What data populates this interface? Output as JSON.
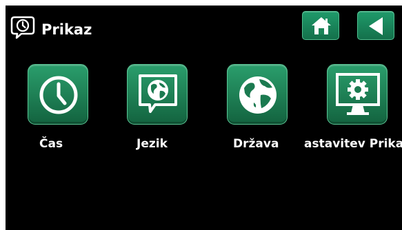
{
  "header": {
    "icon": "speech-bubble-clock-icon",
    "title": "Prikaz"
  },
  "nav": {
    "home_icon": "home-icon",
    "back_icon": "back-arrow-icon"
  },
  "tiles": [
    {
      "label": "Čas",
      "icon": "clock-icon"
    },
    {
      "label": "Jezik",
      "icon": "globe-speech-bubble-icon"
    },
    {
      "label": "Država",
      "icon": "globe-icon"
    },
    {
      "label": "astavitev Prika",
      "icon": "monitor-gear-icon"
    }
  ],
  "colors": {
    "background": "#000000",
    "accent_green": "#1b8a5a",
    "text": "#ffffff"
  }
}
